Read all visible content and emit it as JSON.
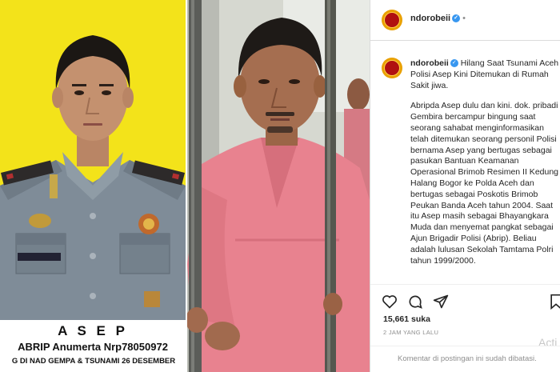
{
  "photo": {
    "left_caption": {
      "name": "A S E P",
      "rank": "ABRIP Anumerta Nrp78050972",
      "place": "G DI NAD GEMPA & TSUNAMI 26 DESEMBER"
    }
  },
  "post": {
    "username": "ndorobeii",
    "verified_mark": "✓",
    "header_extra": "•",
    "title": "Hilang Saat Tsunami Aceh Polisi Asep Kini Ditemukan di Rumah Sakit jiwa.",
    "body": "Abripda Asep dulu dan kini. dok. pribadi\nGembira bercampur bingung saat seorang sahabat menginformasikan telah ditemukan seorang personil Polisi bernama Asep yang bertugas sebagai pasukan Bantuan Keamanan Operasional Brimob Resimen II Kedung Halang Bogor ke Polda Aceh dan bertugas sebagai Poskotis Brimob Peukan Banda Aceh tahun 2004. Saat itu  Asep masih sebagai Bhayangkara Muda dan menyemat pangkat sebagai Ajun Brigadir Polisi  (Abrip).  Beliau adalah lulusan Sekolah Tamtama Polri tahun 1999/2000.",
    "likes": "15,661 suka",
    "time": "2 JAM YANG LALU",
    "comment_placeholder": "Komentar di postingan ini sudah dibatasi.",
    "watermark": "Acti"
  },
  "colors": {
    "yellow_bg": "#f3e31a",
    "uniform": "#7f8c98",
    "gown": "#e8828f",
    "bars": "#5b5d59",
    "verified": "#3897f0"
  },
  "icons": [
    "heart-icon",
    "comment-icon",
    "share-icon",
    "bookmark-icon"
  ]
}
